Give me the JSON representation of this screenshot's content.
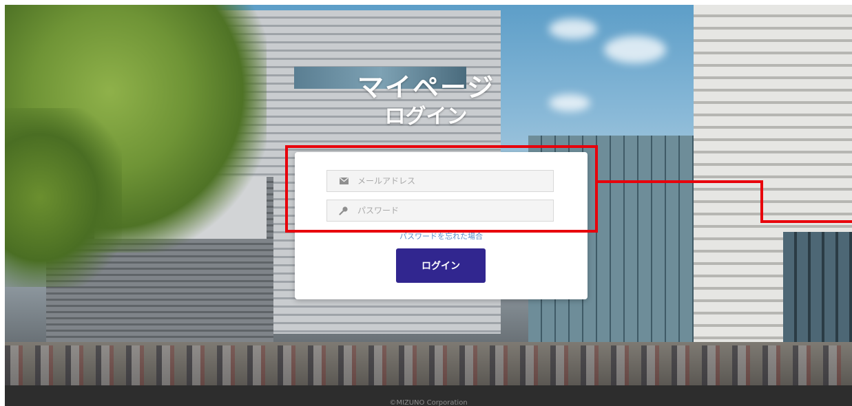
{
  "header": {
    "title": "マイページ",
    "subtitle": "ログイン"
  },
  "login_form": {
    "email": {
      "placeholder": "メールアドレス",
      "value": "",
      "icon": "envelope-icon"
    },
    "password": {
      "placeholder": "パスワード",
      "value": "",
      "icon": "key-icon"
    },
    "forgot_password_label": "パスワードを忘れた場合",
    "login_button_label": "ログイン"
  },
  "annotation": {
    "highlight_color": "#e8000b"
  },
  "colors": {
    "button": "#31268f",
    "link": "#5a8dc9",
    "footer_bg": "#2d2d2d"
  },
  "footer": {
    "copyright": "©MIZUNO Corporation"
  }
}
